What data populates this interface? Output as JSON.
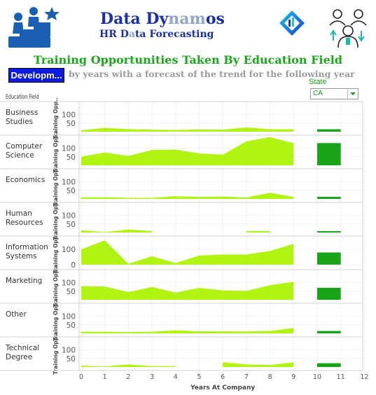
{
  "header": {
    "brand_prefix": "Data Dy",
    "brand_accent": "nam",
    "brand_suffix": "os",
    "subtitle_prefix": "HR D",
    "subtitle_accent": "a",
    "subtitle_suffix": "ta Forecasting",
    "title": "Training Opportunities Taken By Education Field",
    "department_chip": "Developm...",
    "description": "by years with a forecast of the trend for the following year"
  },
  "filters": {
    "state_label": "State",
    "state_value": "CA"
  },
  "colors": {
    "area_fill": "#b1f413",
    "forecast_bar": "#18a318",
    "title_green": "#1aa81a",
    "brand_blue": "#1a2fb0",
    "chip_blue": "#0d1ae0"
  },
  "chart_data": {
    "type": "area",
    "title": "Training Opportunities Taken By Education Field",
    "row_header": "Education Field",
    "ylabel": "Training Opp..",
    "xlabel": "Years At Company",
    "x_ticks": [
      "0",
      "1",
      "2",
      "3",
      "4",
      "5",
      "6",
      "7",
      "8",
      "9",
      "10",
      "11",
      "12"
    ],
    "xlim": [
      0,
      12
    ],
    "forecast_interval": [
      10,
      11
    ],
    "grid": true,
    "rows": [
      {
        "field": "Business Studies",
        "lines": [
          "Business",
          "Studies"
        ],
        "y_ticks": [
          "100",
          "50"
        ],
        "ylim": [
          0,
          160
        ],
        "x": [
          0,
          1,
          2,
          3,
          4,
          5,
          6,
          7,
          8,
          9
        ],
        "values": [
          8,
          22,
          15,
          12,
          10,
          13,
          12,
          25,
          14,
          14
        ],
        "forecast": 14
      },
      {
        "field": "Computer Science",
        "lines": [
          "Computer",
          "Science"
        ],
        "y_ticks": [
          "100",
          "50"
        ],
        "ylim": [
          0,
          160
        ],
        "x": [
          0,
          1,
          2,
          3,
          4,
          5,
          6,
          7,
          8,
          9
        ],
        "values": [
          50,
          75,
          55,
          90,
          92,
          70,
          62,
          140,
          165,
          130
        ],
        "forecast": 130
      },
      {
        "field": "Economics",
        "lines": [
          "Economics"
        ],
        "y_ticks": [
          "100",
          "50"
        ],
        "ylim": [
          0,
          160
        ],
        "x": [
          0,
          1,
          2,
          3,
          4,
          5,
          6,
          7,
          8,
          9
        ],
        "values": [
          10,
          10,
          6,
          6,
          16,
          12,
          14,
          8,
          36,
          12
        ],
        "forecast": 12
      },
      {
        "field": "Human Resources",
        "lines": [
          "Human",
          "Resources"
        ],
        "y_ticks": [
          "100",
          "50"
        ],
        "ylim": [
          0,
          160
        ],
        "segments": [
          {
            "x": [
              0,
              1,
              2,
              3
            ],
            "values": [
              13,
              2,
              18,
              8
            ]
          },
          {
            "x": [
              7,
              8
            ],
            "values": [
              8,
              8
            ]
          }
        ],
        "forecast": 8
      },
      {
        "field": "Information Systems",
        "lines": [
          "Information",
          "Systems"
        ],
        "y_ticks": [
          "100",
          "0"
        ],
        "ylim": [
          -10,
          170
        ],
        "x": [
          0,
          1,
          2,
          3,
          4,
          5,
          6,
          7,
          8,
          9
        ],
        "values": [
          100,
          160,
          5,
          55,
          10,
          60,
          67,
          67,
          90,
          137
        ],
        "forecast": 80
      },
      {
        "field": "Marketing",
        "lines": [
          "Marketing"
        ],
        "y_ticks": [
          "100",
          "50"
        ],
        "ylim": [
          0,
          160
        ],
        "x": [
          0,
          1,
          2,
          3,
          4,
          5,
          6,
          7,
          8,
          9
        ],
        "values": [
          80,
          78,
          45,
          75,
          42,
          70,
          55,
          52,
          85,
          105
        ],
        "forecast": 70
      },
      {
        "field": "Other",
        "lines": [
          "Other"
        ],
        "y_ticks": [
          "100",
          "50"
        ],
        "ylim": [
          0,
          160
        ],
        "x": [
          0,
          1,
          2,
          3,
          4,
          5,
          6,
          7,
          8,
          9
        ],
        "values": [
          10,
          10,
          7,
          10,
          18,
          12,
          12,
          11,
          14,
          32
        ],
        "forecast": 14
      },
      {
        "field": "Technical Degree",
        "lines": [
          "Technical",
          "Degree"
        ],
        "y_ticks": [
          "100",
          "50"
        ],
        "ylim": [
          0,
          160
        ],
        "segments": [
          {
            "x": [
              0,
              1,
              2,
              3,
              4
            ],
            "values": [
              8,
              3,
              15,
              5,
              5
            ]
          },
          {
            "x": [
              6,
              7,
              8,
              9
            ],
            "values": [
              28,
              15,
              12,
              27
            ]
          }
        ],
        "forecast": 22
      }
    ]
  }
}
